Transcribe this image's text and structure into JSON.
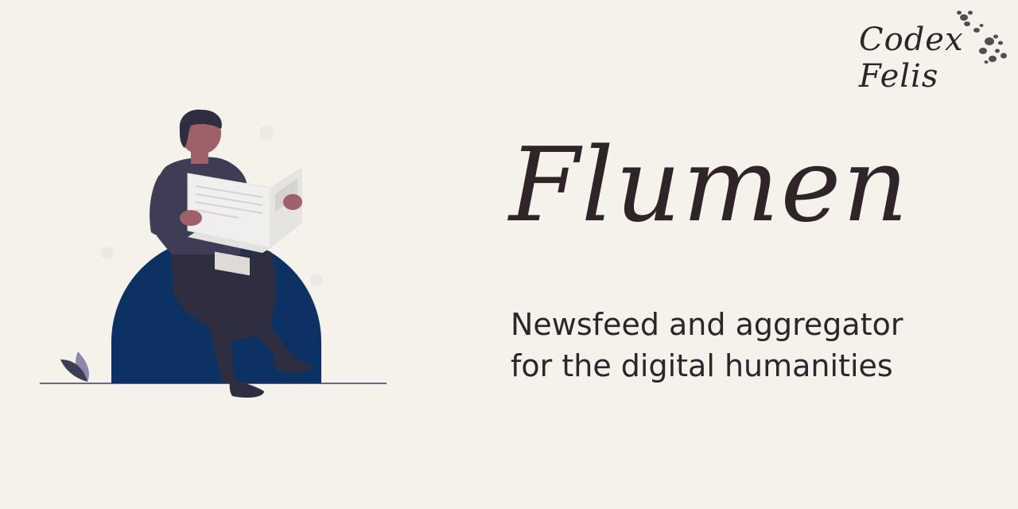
{
  "logo": {
    "line1": "Codex",
    "line2": "Felis"
  },
  "title": "Flumen",
  "subtitle": {
    "line1": "Newsfeed and aggregator",
    "line2": "for the digital humanities"
  },
  "illustration": {
    "icon": "person-reading-newspaper-icon"
  },
  "colors": {
    "background": "#f5f2ec",
    "text": "#2f2428",
    "mound": "#0b3262",
    "jacket": "#3f3d56",
    "skin": "#9e616a",
    "pants": "#2f2e41"
  }
}
